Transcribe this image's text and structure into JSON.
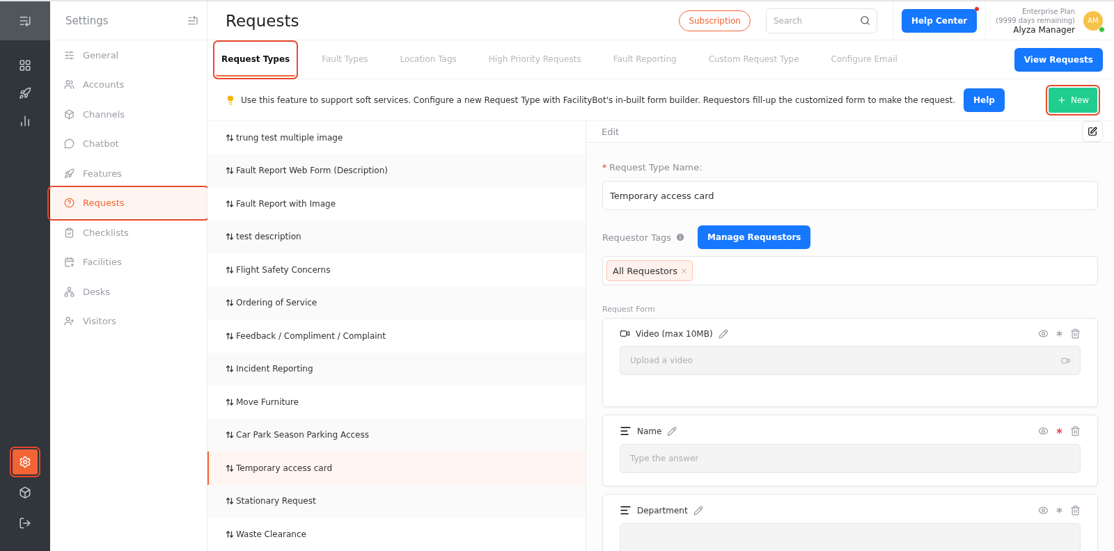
{
  "rail": {
    "items": [
      {
        "kind": "menu"
      },
      {
        "kind": "dashboard",
        "selected": false
      },
      {
        "kind": "rocket",
        "selected": false
      },
      {
        "kind": "chart",
        "selected": false
      }
    ],
    "bottom": [
      {
        "kind": "settings",
        "selected": true,
        "callout": true
      },
      {
        "kind": "box",
        "selected": false,
        "callout": false
      },
      {
        "kind": "logout",
        "selected": false,
        "callout": false
      }
    ]
  },
  "sidebar": {
    "title": "Settings",
    "items": [
      {
        "label": "General",
        "kind": "general",
        "selected": false,
        "callout": false
      },
      {
        "label": "Accounts",
        "kind": "accounts",
        "selected": false,
        "callout": false
      },
      {
        "label": "Channels",
        "kind": "channels",
        "selected": false,
        "callout": false
      },
      {
        "label": "Chatbot",
        "kind": "chatbot",
        "selected": false,
        "callout": false
      },
      {
        "label": "Features",
        "kind": "features",
        "selected": false,
        "callout": false
      },
      {
        "label": "Requests",
        "kind": "requests",
        "selected": true,
        "callout": true
      },
      {
        "label": "Checklists",
        "kind": "checklists",
        "selected": false,
        "callout": false
      },
      {
        "label": "Facilities",
        "kind": "facilities",
        "selected": false,
        "callout": false
      },
      {
        "label": "Desks",
        "kind": "desks",
        "selected": false,
        "callout": false
      },
      {
        "label": "Visitors",
        "kind": "visitors",
        "selected": false,
        "callout": false
      }
    ]
  },
  "header": {
    "title": "Requests",
    "subscription": "Subscription",
    "search": {
      "placeholder": "Search"
    },
    "help_center": "Help Center",
    "plan": "Enterprise Plan",
    "days": "(9999 days remaining)",
    "user": "Alyza Manager",
    "avatar": "AM"
  },
  "tabs": [
    {
      "label": "Request Types",
      "selected": true,
      "callout": true
    },
    {
      "label": "Fault Types",
      "selected": false,
      "callout": false
    },
    {
      "label": "Location Tags",
      "selected": false,
      "callout": false
    },
    {
      "label": "High Priority Requests",
      "selected": false,
      "callout": false
    },
    {
      "label": "Fault Reporting",
      "selected": false,
      "callout": false
    },
    {
      "label": "Custom Request Type",
      "selected": false,
      "callout": false
    },
    {
      "label": "Configure Email",
      "selected": false,
      "callout": false
    }
  ],
  "view_requests": "View Requests",
  "info": {
    "text": "Use this feature to support soft services. Configure a new Request Type with FacilityBot's in-built form builder. Requestors fill-up the customized form to make the request.",
    "help": "Help",
    "new": {
      "label": "New",
      "callout": true
    }
  },
  "request_types": [
    {
      "label": "trung test multiple image",
      "selected": false
    },
    {
      "label": "Fault Report Web Form (Description)",
      "selected": false
    },
    {
      "label": "Fault Report with Image",
      "selected": false
    },
    {
      "label": "test description",
      "selected": false
    },
    {
      "label": "Flight Safety Concerns",
      "selected": false
    },
    {
      "label": "Ordering of Service",
      "selected": false
    },
    {
      "label": "Feedback / Compliment / Complaint",
      "selected": false
    },
    {
      "label": "Incident Reporting",
      "selected": false
    },
    {
      "label": "Move Furniture",
      "selected": false
    },
    {
      "label": "Car Park Season Parking Access",
      "selected": false
    },
    {
      "label": "Temporary access card",
      "selected": true
    },
    {
      "label": "Stationary Request",
      "selected": false
    },
    {
      "label": "Waste Clearance",
      "selected": false
    }
  ],
  "edit": {
    "title": "Edit",
    "name_required_mark": "*",
    "name_label": "Request Type Name",
    "name_suffix": ":",
    "name_value": "Temporary access card",
    "tags_label": "Requestor Tags",
    "manage": "Manage Requestors",
    "tags": [
      "All Requestors"
    ],
    "form_label": "Request Form",
    "fields": [
      {
        "kind": "video",
        "label": "Video (max 10MB)",
        "placeholder": "Upload a video",
        "required": false
      },
      {
        "kind": "text",
        "label": "Name",
        "placeholder": "Type the answer",
        "required": true
      },
      {
        "kind": "text",
        "label": "Department",
        "required": false
      }
    ]
  }
}
